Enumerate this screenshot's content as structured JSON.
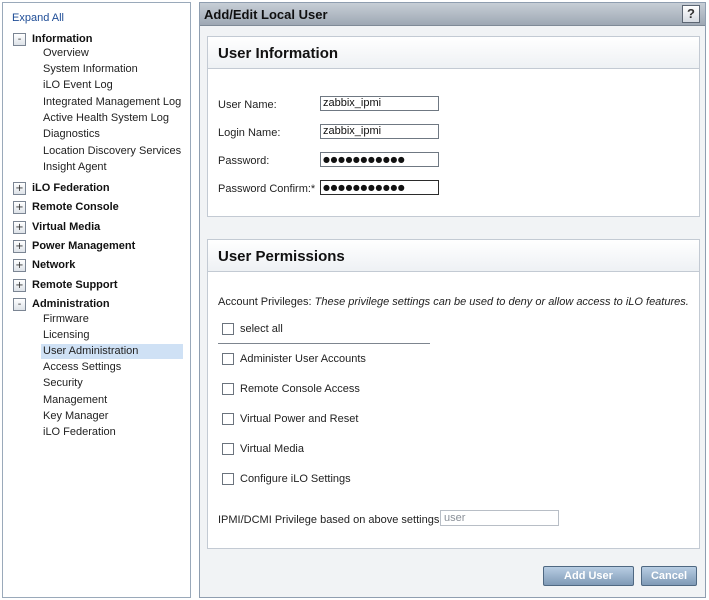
{
  "nav": {
    "expand_all": "Expand All",
    "groups": [
      {
        "toggle": "-",
        "label": "Information"
      },
      {
        "toggle": "+",
        "label": "iLO Federation"
      },
      {
        "toggle": "+",
        "label": "Remote Console"
      },
      {
        "toggle": "+",
        "label": "Virtual Media"
      },
      {
        "toggle": "+",
        "label": "Power Management"
      },
      {
        "toggle": "+",
        "label": "Network"
      },
      {
        "toggle": "+",
        "label": "Remote Support"
      },
      {
        "toggle": "-",
        "label": "Administration"
      }
    ],
    "information_items": [
      "Overview",
      "System Information",
      "iLO Event Log",
      "Integrated Management Log",
      "Active Health System Log",
      "Diagnostics",
      "Location Discovery Services",
      "Insight Agent"
    ],
    "administration_items": [
      "Firmware",
      "Licensing",
      "User Administration",
      "Access Settings",
      "Security",
      "Management",
      "Key Manager",
      "iLO Federation"
    ],
    "selected_item": "User Administration"
  },
  "header": {
    "title": "Add/Edit Local User",
    "help": "?"
  },
  "user_info": {
    "title": "User Information",
    "user_name_label": "User Name:",
    "user_name_value": "zabbix_ipmi",
    "login_name_label": "Login Name:",
    "login_name_value": "zabbix_ipmi",
    "password_label": "Password:",
    "password_value": "●●●●●●●●●●●",
    "password_confirm_label": "Password Confirm:*",
    "password_confirm_value": "●●●●●●●●●●●"
  },
  "permissions": {
    "title": "User Permissions",
    "account_privileges_label": "Account Privileges:",
    "account_privileges_note": "These privilege settings can be used to deny or allow access to iLO features.",
    "select_all": "select all",
    "items": [
      "Administer User Accounts",
      "Remote Console Access",
      "Virtual Power and Reset",
      "Virtual Media",
      "Configure iLO Settings"
    ],
    "ipmi_label": "IPMI/DCMI Privilege based on above settings:",
    "ipmi_value": "user"
  },
  "buttons": {
    "add_user": "Add User",
    "cancel": "Cancel"
  }
}
